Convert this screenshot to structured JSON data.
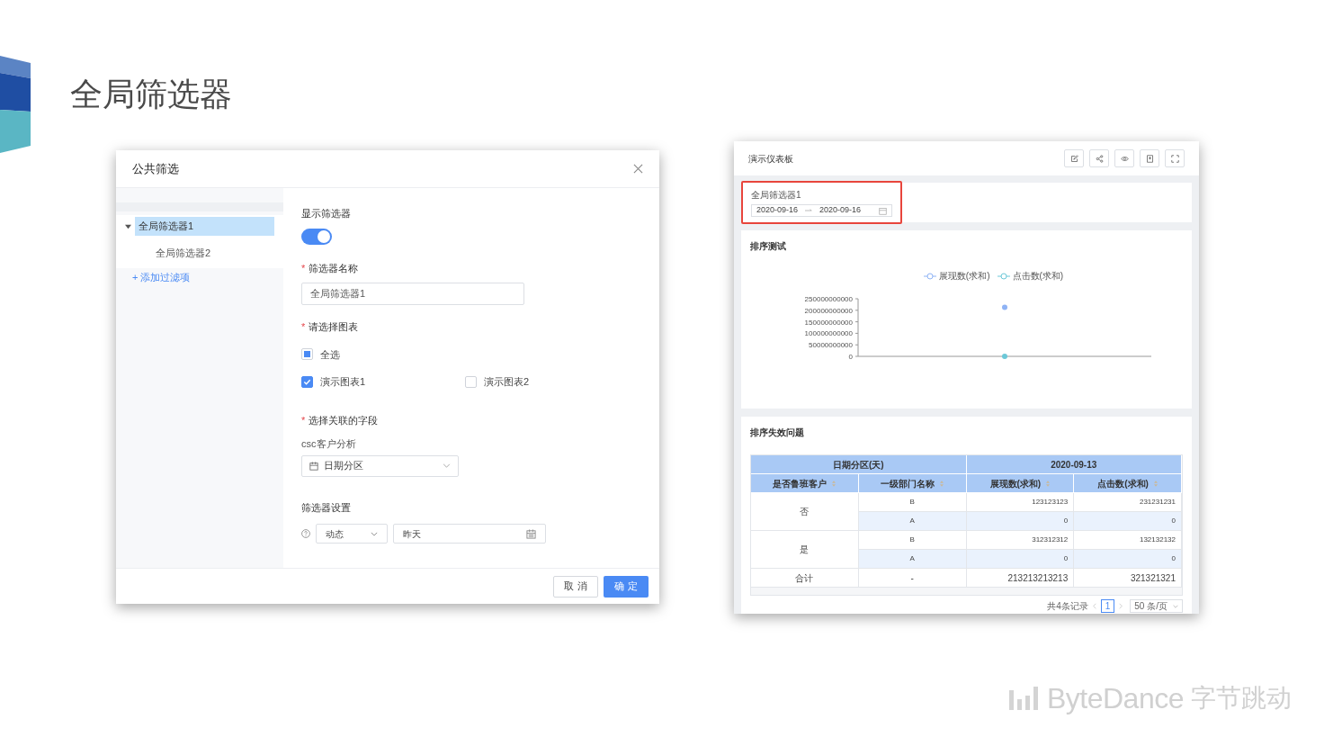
{
  "slide": {
    "title": "全局筛选器",
    "logo": {
      "wordmark": "ByteDance",
      "chinese": "字节跳动"
    }
  },
  "dialog": {
    "title": "公共筛选",
    "tree": [
      {
        "label": "全局筛选器1",
        "selected": true,
        "expanded": true,
        "children": [
          {
            "label": "全局筛选器2",
            "selected": false
          }
        ]
      }
    ],
    "add_link": "+ 添加过滤项",
    "show_filter": {
      "label": "显示筛选器",
      "on": true
    },
    "name_field": {
      "label": "筛选器名称",
      "required_mark": "*",
      "value": "全局筛选器1"
    },
    "chart_select": {
      "label": "请选择图表",
      "required_mark": "*",
      "options": [
        {
          "kind": "select_all",
          "label": "全选",
          "indeterminate": true
        },
        {
          "kind": "chart",
          "label": "演示图表1",
          "checked": true
        },
        {
          "kind": "chart",
          "label": "演示图表2",
          "checked": false
        }
      ]
    },
    "field_select": {
      "label": "选择关联的字段",
      "required_mark": "*",
      "source": "csc客户分析",
      "value": "日期分区"
    },
    "settings": {
      "label": "筛选器设置",
      "mode": "动态",
      "date": "昨天"
    },
    "buttons": [
      {
        "label": "取 消",
        "primary": false
      },
      {
        "label": "确 定",
        "primary": true
      }
    ]
  },
  "dashboard": {
    "title": "演示仪表板",
    "filter": {
      "label": "全局筛选器1",
      "start": "2020-09-16",
      "end": "2020-09-16",
      "highlighted": true
    },
    "chart_panel": {
      "title": "排序测试",
      "chart_data": {
        "type": "scatter",
        "ylim": [
          0,
          250000000000
        ],
        "yticks": [
          {
            "value": 0,
            "label": "0"
          },
          {
            "value": 50000000000,
            "label": "50000000000"
          },
          {
            "value": 100000000000,
            "label": "100000000000"
          },
          {
            "value": 150000000000,
            "label": "150000000000"
          },
          {
            "value": 200000000000,
            "label": "200000000000"
          },
          {
            "value": 250000000000,
            "label": "250000000000"
          }
        ],
        "series": [
          {
            "name": "展现数(求和)",
            "color": "#8fb3f5",
            "values": [
              213000000000
            ]
          },
          {
            "name": "点击数(求和)",
            "color": "#6cc8d8",
            "values": [
              0
            ]
          }
        ]
      }
    },
    "table_panel": {
      "title": "排序失效问题",
      "group_headers": [
        "日期分区(天)",
        "2020-09-13"
      ],
      "columns": [
        "是否鲁班客户",
        "一级部门名称",
        "展现数(求和)",
        "点击数(求和)"
      ],
      "groups": [
        {
          "label": "否",
          "rows": [
            [
              "B",
              "123123123",
              "231231231"
            ],
            [
              "A",
              "0",
              "0"
            ]
          ]
        },
        {
          "label": "是",
          "rows": [
            [
              "B",
              "312312312",
              "132132132"
            ],
            [
              "A",
              "0",
              "0"
            ]
          ]
        }
      ],
      "total": [
        "合计",
        "-",
        "213213213213",
        "321321321"
      ],
      "pagination": {
        "summary": "共4条记录",
        "page": "1",
        "page_size": "50 条/页"
      }
    }
  }
}
